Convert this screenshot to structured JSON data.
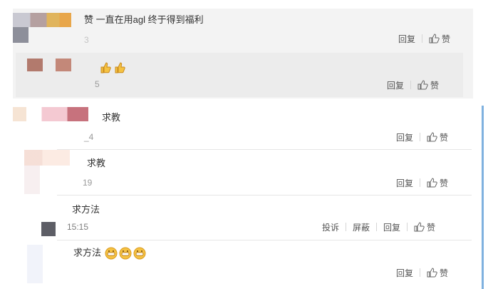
{
  "comments": [
    {
      "text": "赞 一直在用agl 终于得到福利",
      "time": "3",
      "actions": [
        "回复",
        "赞"
      ]
    },
    {
      "text": "",
      "emoji_count": 2,
      "emoji_type": "thumbs-up-icon",
      "time": "5",
      "actions": [
        "回复",
        "赞"
      ]
    },
    {
      "text": "求教",
      "time": "_4",
      "actions": [
        "回复",
        "赞"
      ]
    },
    {
      "text": "求教",
      "time": "19",
      "actions": [
        "回复",
        "赞"
      ]
    },
    {
      "text": "求方法",
      "time": "15:15",
      "actions": [
        "投诉",
        "屏蔽",
        "回复",
        "赞"
      ]
    },
    {
      "text": "求方法",
      "emoji_count": 3,
      "emoji_type": "grin-face-icon",
      "actions": [
        "回复",
        "赞"
      ]
    }
  ],
  "colors": {
    "accent": "#7fb1df",
    "panel": "#f3f3f3",
    "emoji_yellow": "#f5c242"
  }
}
